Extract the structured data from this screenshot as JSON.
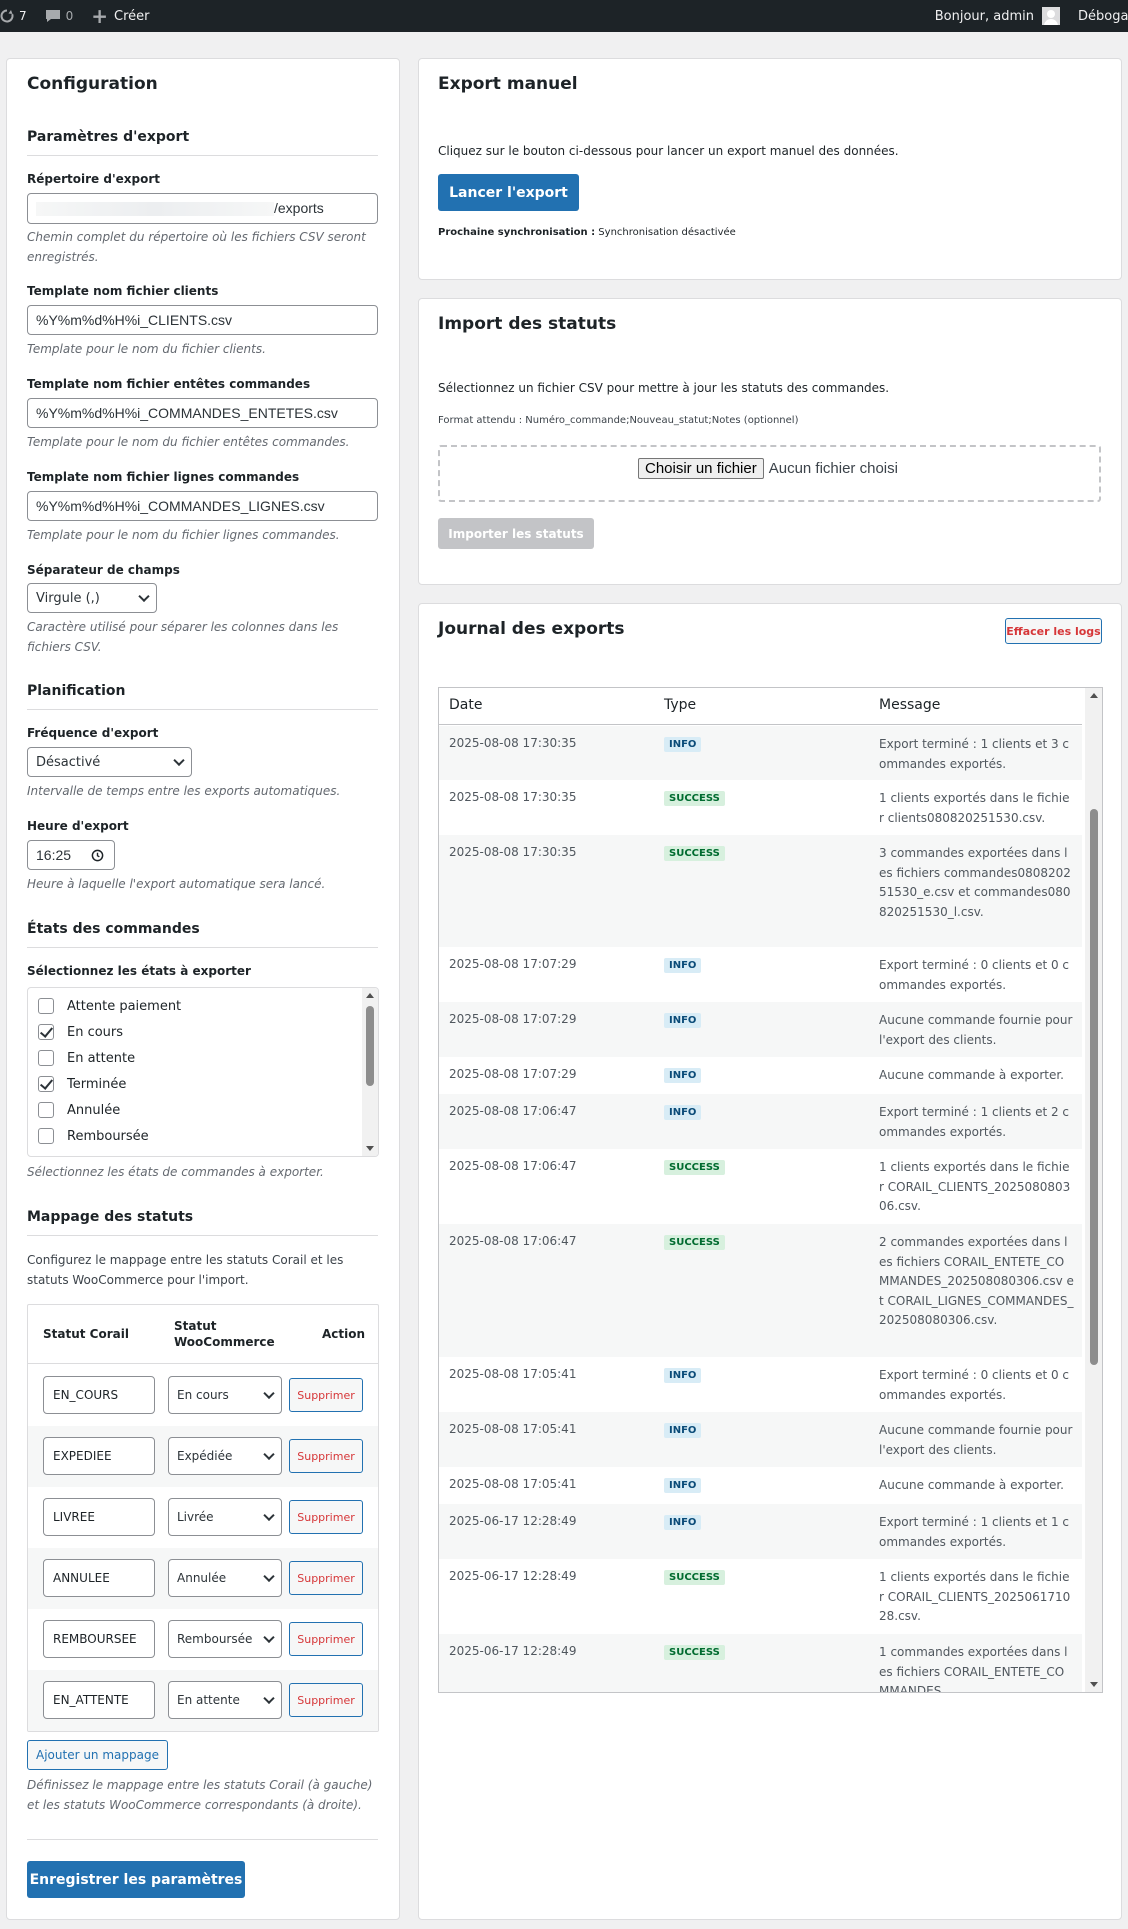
{
  "adminbar": {
    "updates_count": "7",
    "comments_count": "0",
    "new_label": "Créer",
    "greeting": "Bonjour, admin",
    "debug_label": "Débogage"
  },
  "config": {
    "title": "Configuration",
    "export_params_title": "Paramètres d'export",
    "export_dir_label": "Répertoire d'export",
    "export_dir_value": "/exports",
    "export_dir_desc": "Chemin complet du répertoire où les fichiers CSV seront enregistrés.",
    "clients_tpl_label": "Template nom fichier clients",
    "clients_tpl_value": "%Y%m%d%H%i_CLIENTS.csv",
    "clients_tpl_desc": "Template pour le nom du fichier clients.",
    "headers_tpl_label": "Template nom fichier entêtes commandes",
    "headers_tpl_value": "%Y%m%d%H%i_COMMANDES_ENTETES.csv",
    "headers_tpl_desc": "Template pour le nom du fichier entêtes commandes.",
    "lines_tpl_label": "Template nom fichier lignes commandes",
    "lines_tpl_value": "%Y%m%d%H%i_COMMANDES_LIGNES.csv",
    "lines_tpl_desc": "Template pour le nom du fichier lignes commandes.",
    "separator_label": "Séparateur de champs",
    "separator_value": "Virgule (,)",
    "separator_desc": "Caractère utilisé pour séparer les colonnes dans les fichiers CSV.",
    "planning_title": "Planification",
    "frequency_label": "Fréquence d'export",
    "frequency_value": "Désactivé",
    "frequency_desc": "Intervalle de temps entre les exports automatiques.",
    "hour_label": "Heure d'export",
    "hour_value": "16:25",
    "hour_desc": "Heure à laquelle l'export automatique sera lancé.",
    "states_title": "États des commandes",
    "states_label": "Sélectionnez les états à exporter",
    "states": [
      {
        "label": "Attente paiement",
        "checked": false
      },
      {
        "label": "En cours",
        "checked": true
      },
      {
        "label": "En attente",
        "checked": false
      },
      {
        "label": "Terminée",
        "checked": true
      },
      {
        "label": "Annulée",
        "checked": false
      },
      {
        "label": "Remboursée",
        "checked": false
      }
    ],
    "states_desc": "Sélectionnez les états de commandes à exporter.",
    "mapping_title": "Mappage des statuts",
    "mapping_intro": "Configurez le mappage entre les statuts Corail et les statuts WooCommerce pour l'import.",
    "mapping_headers": {
      "corail": "Statut Corail",
      "woo": "Statut WooCommerce",
      "action": "Action"
    },
    "mappings": [
      {
        "corail": "EN_COURS",
        "woo": "En cours",
        "action": "Supprimer"
      },
      {
        "corail": "EXPEDIEE",
        "woo": "Expédiée",
        "action": "Supprimer"
      },
      {
        "corail": "LIVREE",
        "woo": "Livrée",
        "action": "Supprimer"
      },
      {
        "corail": "ANNULEE",
        "woo": "Annulée",
        "action": "Supprimer"
      },
      {
        "corail": "REMBOURSEE",
        "woo": "Remboursée",
        "action": "Supprimer"
      },
      {
        "corail": "EN_ATTENTE",
        "woo": "En attente",
        "action": "Supprimer"
      }
    ],
    "add_mapping": "Ajouter un mappage",
    "mapping_desc": "Définissez le mappage entre les statuts Corail (à gauche) et les statuts WooCommerce correspondants (à droite).",
    "save_label": "Enregistrer les paramètres"
  },
  "export_manual": {
    "title": "Export manuel",
    "intro": "Cliquez sur le bouton ci-dessous pour lancer un export manuel des données.",
    "button": "Lancer l'export",
    "next_sync_label": "Prochaine synchronisation :",
    "next_sync_value": "Synchronisation désactivée"
  },
  "import_status": {
    "title": "Import des statuts",
    "intro": "Sélectionnez un fichier CSV pour mettre à jour les statuts des commandes.",
    "format": "Format attendu : Numéro_commande;Nouveau_statut;Notes (optionnel)",
    "choose_file": "Choisir un fichier",
    "no_file": "Aucun fichier choisi",
    "button": "Importer les statuts"
  },
  "log": {
    "title": "Journal des exports",
    "clear_button": "Effacer les logs",
    "headers": {
      "date": "Date",
      "type": "Type",
      "message": "Message"
    },
    "rows": [
      {
        "date": "2025-08-08 17:30:35",
        "type": "INFO",
        "message": "Export terminé : 1 clients et 3 commandes exportés."
      },
      {
        "date": "2025-08-08 17:30:35",
        "type": "SUCCESS",
        "message": "1 clients exportés dans le fichier clients080820251530.csv."
      },
      {
        "date": "2025-08-08 17:30:35",
        "type": "SUCCESS",
        "message": "3 commandes exportées dans les fichiers commandes080820251530_e.csv et commandes080820251530_l.csv."
      },
      {
        "date": "2025-08-08 17:07:29",
        "type": "INFO",
        "message": "Export terminé : 0 clients et 0 commandes exportés."
      },
      {
        "date": "2025-08-08 17:07:29",
        "type": "INFO",
        "message": "Aucune commande fournie pour l'export des clients."
      },
      {
        "date": "2025-08-08 17:07:29",
        "type": "INFO",
        "message": "Aucune commande à exporter."
      },
      {
        "date": "2025-08-08 17:06:47",
        "type": "INFO",
        "message": "Export terminé : 1 clients et 2 commandes exportés."
      },
      {
        "date": "2025-08-08 17:06:47",
        "type": "SUCCESS",
        "message": "1 clients exportés dans le fichier CORAIL_CLIENTS_202508080306.csv."
      },
      {
        "date": "2025-08-08 17:06:47",
        "type": "SUCCESS",
        "message": "2 commandes exportées dans les fichiers CORAIL_ENTETE_COMMANDES_202508080306.csv et CORAIL_LIGNES_COMMANDES_202508080306.csv."
      },
      {
        "date": "2025-08-08 17:05:41",
        "type": "INFO",
        "message": "Export terminé : 0 clients et 0 commandes exportés."
      },
      {
        "date": "2025-08-08 17:05:41",
        "type": "INFO",
        "message": "Aucune commande fournie pour l'export des clients."
      },
      {
        "date": "2025-08-08 17:05:41",
        "type": "INFO",
        "message": "Aucune commande à exporter."
      },
      {
        "date": "2025-06-17 12:28:49",
        "type": "INFO",
        "message": "Export terminé : 1 clients et 1 commandes exportés."
      },
      {
        "date": "2025-06-17 12:28:49",
        "type": "SUCCESS",
        "message": "1 clients exportés dans le fichier CORAIL_CLIENTS_202506171028.csv."
      },
      {
        "date": "2025-06-17 12:28:49",
        "type": "SUCCESS",
        "message": "1 commandes exportées dans les fichiers CORAIL_ENTETE_COMMANDES"
      }
    ]
  }
}
